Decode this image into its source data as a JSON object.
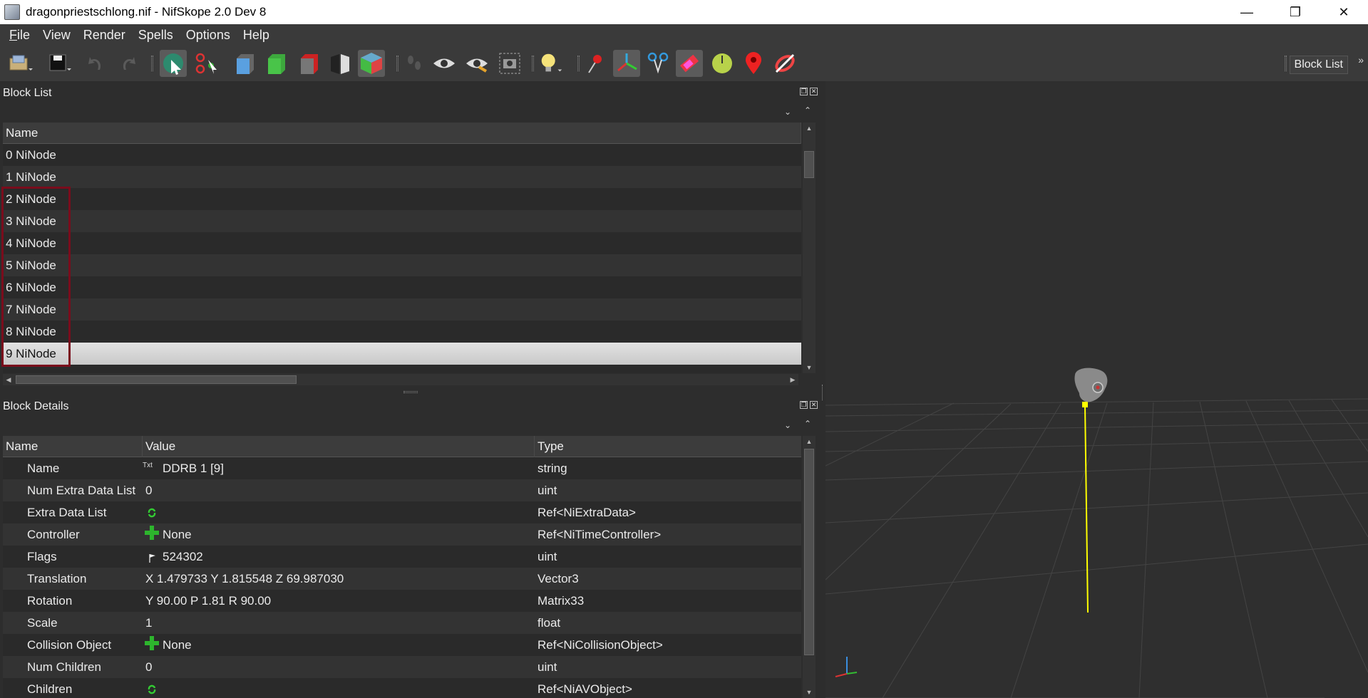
{
  "window": {
    "title": "dragonpriestschlong.nif - NifSkope 2.0 Dev 8",
    "minimize_glyph": "—",
    "maximize_glyph": "❐",
    "close_glyph": "✕"
  },
  "menu": {
    "items": [
      {
        "accel": "F",
        "rest": "ile"
      },
      {
        "accel": "",
        "rest": "View"
      },
      {
        "accel": "",
        "rest": "Render"
      },
      {
        "accel": "",
        "rest": "Spells"
      },
      {
        "accel": "",
        "rest": "Options"
      },
      {
        "accel": "",
        "rest": "Help"
      }
    ]
  },
  "toolbar": {
    "right_label": "Block List",
    "more_glyph": "»",
    "icons": [
      "open-icon",
      "save-icon",
      "undo-icon",
      "redo-icon",
      "select-object-icon",
      "select-vertex-icon",
      "view-front-icon",
      "view-top-icon",
      "view-side-icon",
      "view-flip-icon",
      "view-user-icon",
      "walk-icon",
      "show-hidden-icon",
      "show-nodes-icon",
      "screenshot-icon",
      "lighting-icon",
      "show-markers-icon",
      "show-axes-icon",
      "show-skeleton-icon",
      "show-havok-icon",
      "show-constraints-icon",
      "show-furniture-icon",
      "show-connections-icon"
    ]
  },
  "block_list": {
    "title": "Block List",
    "column": "Name",
    "rows": [
      "0 NiNode",
      "1 NiNode",
      "2 NiNode",
      "3 NiNode",
      "4 NiNode",
      "5 NiNode",
      "6 NiNode",
      "7 NiNode",
      "8 NiNode",
      "9 NiNode"
    ],
    "selected_index": 9
  },
  "block_details": {
    "title": "Block Details",
    "columns": {
      "name": "Name",
      "value": "Value",
      "type": "Type"
    },
    "rows": [
      {
        "name": "Name",
        "icon": "txt-icon",
        "value": "DDRB 1 [9]",
        "type": "string"
      },
      {
        "name": "Num Extra Data List",
        "icon": "",
        "value": "0",
        "type": "uint"
      },
      {
        "name": "Extra Data List",
        "icon": "refresh-icon",
        "value": "",
        "type": "Ref<NiExtraData>"
      },
      {
        "name": "Controller",
        "icon": "plus-icon",
        "value": "None",
        "type": "Ref<NiTimeController>"
      },
      {
        "name": "Flags",
        "icon": "flag-icon",
        "value": "524302",
        "type": "uint"
      },
      {
        "name": "Translation",
        "icon": "",
        "value": "X 1.479733 Y 1.815548 Z 69.987030",
        "type": "Vector3"
      },
      {
        "name": "Rotation",
        "icon": "",
        "value": "Y 90.00 P 1.81 R 90.00",
        "type": "Matrix33"
      },
      {
        "name": "Scale",
        "icon": "",
        "value": "1",
        "type": "float"
      },
      {
        "name": "Collision Object",
        "icon": "plus-icon",
        "value": "None",
        "type": "Ref<NiCollisionObject>"
      },
      {
        "name": "Num Children",
        "icon": "",
        "value": "0",
        "type": "uint"
      },
      {
        "name": "Children",
        "icon": "refresh-icon",
        "value": "",
        "type": "Ref<NiAVObject>"
      }
    ]
  },
  "colors": {
    "selection_box": "#7a0c1c",
    "axis_line": "#ffff00"
  }
}
